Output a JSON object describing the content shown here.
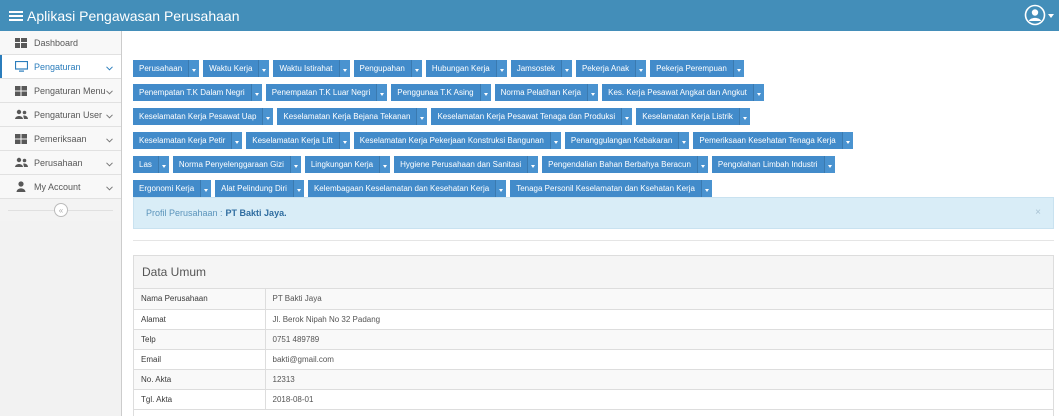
{
  "app": {
    "title": "Aplikasi Pengawasan Perusahaan"
  },
  "sidebar": {
    "items": [
      {
        "label": "Dashboard",
        "icon": "dashboard-icon",
        "has_chevron": false,
        "active": false
      },
      {
        "label": "Pengaturan",
        "icon": "desktop-icon",
        "has_chevron": true,
        "active": true
      },
      {
        "label": "Pengaturan Menu",
        "icon": "grid-icon",
        "has_chevron": true,
        "active": false
      },
      {
        "label": "Pengaturan User",
        "icon": "users-icon",
        "has_chevron": true,
        "active": false
      },
      {
        "label": "Pemeriksaan",
        "icon": "grid-icon",
        "has_chevron": true,
        "active": false
      },
      {
        "label": "Perusahaan",
        "icon": "users-icon",
        "has_chevron": true,
        "active": false
      },
      {
        "label": "My Account",
        "icon": "user-icon",
        "has_chevron": true,
        "active": false
      }
    ],
    "collapse_glyph": "«"
  },
  "toolbar_rows": [
    [
      "Perusahaan",
      "Waktu Kerja",
      "Waktu Istirahat",
      "Pengupahan",
      "Hubungan Kerja",
      "Jamsostek",
      "Pekerja Anak",
      "Pekerja Perempuan"
    ],
    [
      "Penempatan T.K Dalam Negri",
      "Penempatan T.K Luar Negri",
      "Penggunaa T.K Asing",
      "Norma Pelatihan Kerja",
      "Kes. Kerja Pesawat Angkat dan Angkut"
    ],
    [
      "Keselamatan Kerja Pesawat Uap",
      "Keselamatan Kerja Bejana Tekanan",
      "Keselamatan Kerja Pesawat Tenaga dan Produksi",
      "Keselamatan Kerja Listrik"
    ],
    [
      "Keselamatan Kerja Petir",
      "Keselamatan Kerja Lift",
      "Keselamatan Kerja Pekerjaan Konstruksi Bangunan",
      "Penanggulangan Kebakaran",
      "Pemeriksaan Kesehatan Tenaga Kerja"
    ],
    [
      "Las",
      "Norma Penyelenggaraan Gizi",
      "Lingkungan Kerja",
      "Hygiene Perusahaan dan Sanitasi",
      "Pengendalian Bahan Berbahya Beracun",
      "Pengolahan Limbah Industri"
    ],
    [
      "Ergonomi Kerja",
      "Alat Pelindung Diri",
      "Kelembagaan Keselamatan dan Kesehatan Kerja",
      "Tenaga Personil Keselamatan dan Ksehatan Kerja"
    ]
  ],
  "alert": {
    "prefix": "Profil Perusahaan :",
    "company": "PT Bakti Jaya.",
    "close": "×"
  },
  "panel": {
    "title": "Data Umum",
    "rows": [
      {
        "label": "Nama Perusahaan",
        "value": "PT Bakti Jaya"
      },
      {
        "label": "Alamat",
        "value": "Jl. Berok Nipah No 32 Padang"
      },
      {
        "label": "Telp",
        "value": "0751 489789"
      },
      {
        "label": "Email",
        "value": "bakti@gmail.com"
      },
      {
        "label": "No. Akta",
        "value": "12313"
      },
      {
        "label": "Tgl. Akta",
        "value": "2018-08-01"
      }
    ]
  }
}
